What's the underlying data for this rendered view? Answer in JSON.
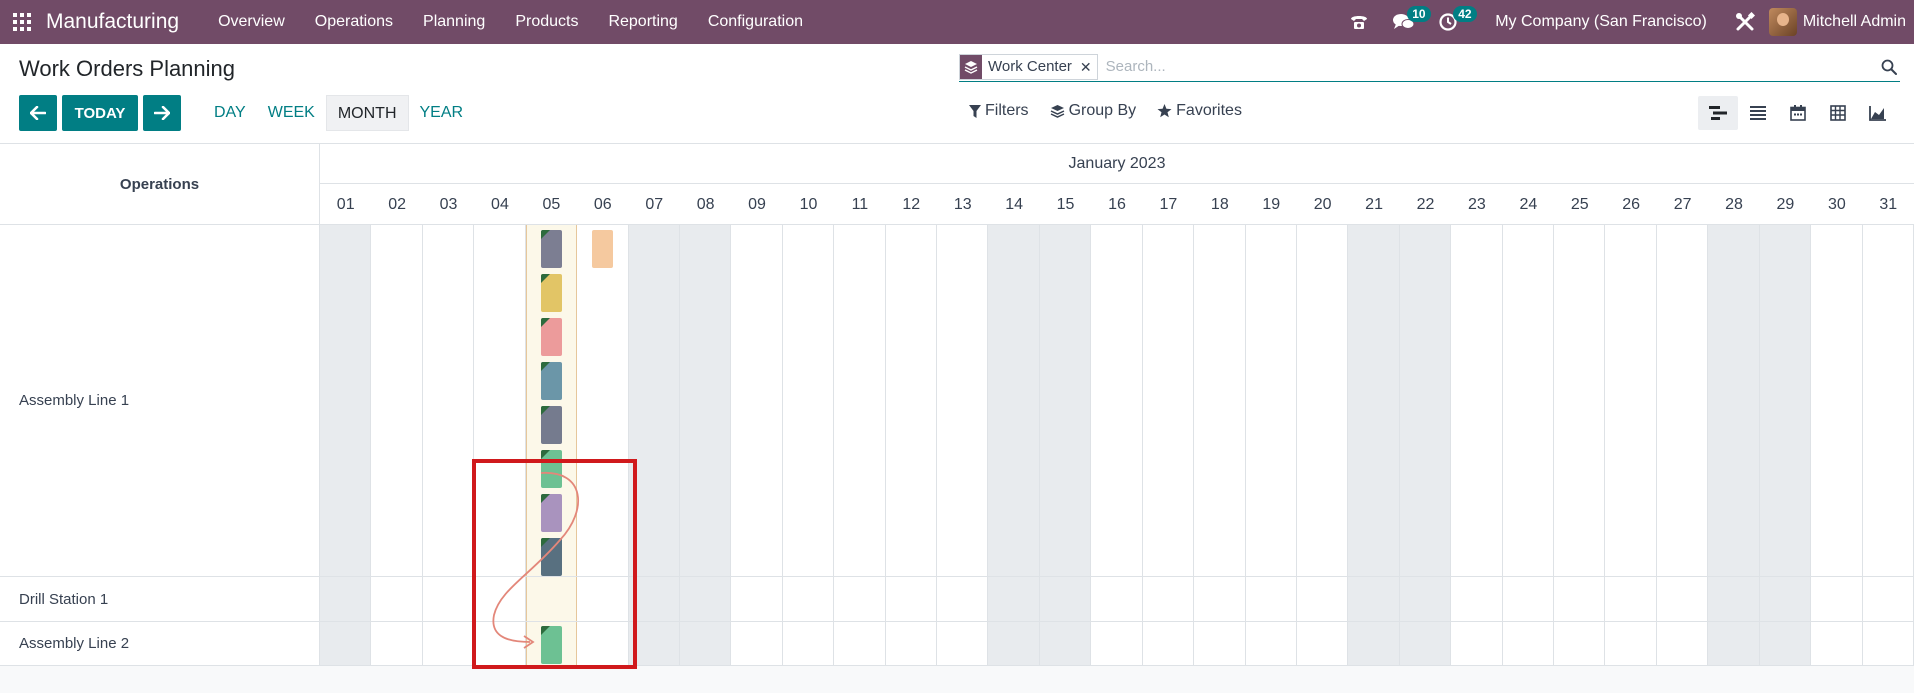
{
  "navbar": {
    "brand": "Manufacturing",
    "menu": [
      "Overview",
      "Operations",
      "Planning",
      "Products",
      "Reporting",
      "Configuration"
    ],
    "messages_count": "10",
    "activities_count": "42",
    "company": "My Company (San Francisco)",
    "user_name": "Mitchell Admin"
  },
  "control_panel": {
    "title": "Work Orders Planning",
    "today_label": "TODAY",
    "scales": [
      "DAY",
      "WEEK",
      "MONTH",
      "YEAR"
    ],
    "active_scale": "MONTH",
    "search": {
      "facet_value": "Work Center",
      "placeholder": "Search..."
    },
    "filters_label": "Filters",
    "group_by_label": "Group By",
    "favorites_label": "Favorites"
  },
  "gantt": {
    "operations_header": "Operations",
    "month_label": "January 2023",
    "days": [
      "01",
      "02",
      "03",
      "04",
      "05",
      "06",
      "07",
      "08",
      "09",
      "10",
      "11",
      "12",
      "13",
      "14",
      "15",
      "16",
      "17",
      "18",
      "19",
      "20",
      "21",
      "22",
      "23",
      "24",
      "25",
      "26",
      "27",
      "28",
      "29",
      "30",
      "31"
    ],
    "weekend_days": [
      "01",
      "07",
      "08",
      "14",
      "15",
      "21",
      "22",
      "28",
      "29"
    ],
    "today_day": "05",
    "rows": [
      "Assembly Line 1",
      "Drill Station 1",
      "Assembly Line 2"
    ],
    "pills": [
      {
        "row": "Assembly Line 1",
        "day": "05",
        "color": "#7c7e92"
      },
      {
        "row": "Assembly Line 1",
        "day": "05",
        "color": "#e2c566"
      },
      {
        "row": "Assembly Line 1",
        "day": "05",
        "color": "#ec9b9b"
      },
      {
        "row": "Assembly Line 1",
        "day": "05",
        "color": "#6b96a8"
      },
      {
        "row": "Assembly Line 1",
        "day": "05",
        "color": "#757b8e"
      },
      {
        "row": "Assembly Line 1",
        "day": "05",
        "color": "#6dc193"
      },
      {
        "row": "Assembly Line 1",
        "day": "05",
        "color": "#a993be"
      },
      {
        "row": "Assembly Line 1",
        "day": "05",
        "color": "#587080"
      },
      {
        "row": "Assembly Line 1",
        "day": "06",
        "color": "#f5c99f"
      },
      {
        "row": "Assembly Line 2",
        "day": "05",
        "color": "#6dc193"
      }
    ]
  }
}
